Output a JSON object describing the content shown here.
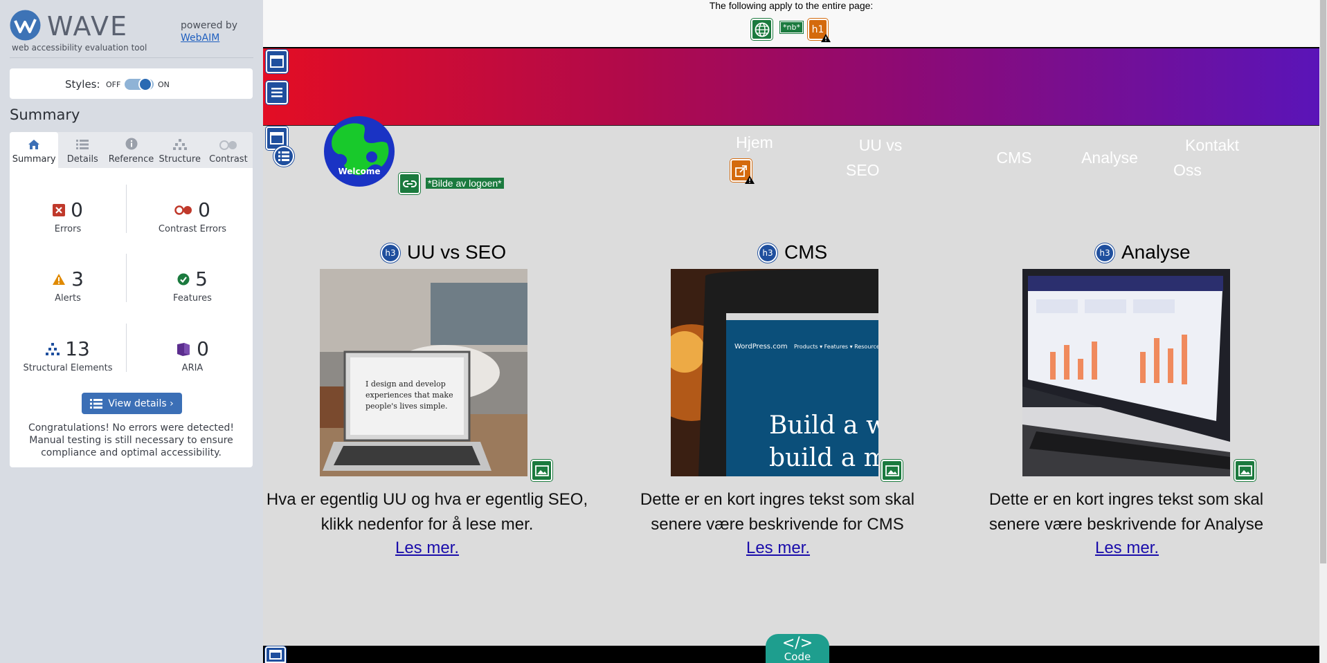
{
  "wave": {
    "logo_text": "WAVE",
    "logo_subtitle": "web accessibility evaluation tool",
    "powered_by": "powered by",
    "powered_link": "WebAIM",
    "styles_label": "Styles:",
    "toggle_off": "OFF",
    "toggle_on": "ON",
    "summary_title": "Summary",
    "tabs": [
      {
        "label": "Summary",
        "icon": "home-icon",
        "active": true
      },
      {
        "label": "Details",
        "icon": "list-icon",
        "active": false
      },
      {
        "label": "Reference",
        "icon": "info-icon",
        "active": false
      },
      {
        "label": "Structure",
        "icon": "hierarchy-icon",
        "active": false
      },
      {
        "label": "Contrast",
        "icon": "contrast-icon",
        "active": false
      }
    ],
    "stats": {
      "errors": {
        "value": "0",
        "label": "Errors",
        "color": "#c0392b"
      },
      "contrast_errors": {
        "value": "0",
        "label": "Contrast Errors",
        "color": "#c0392b"
      },
      "alerts": {
        "value": "3",
        "label": "Alerts",
        "color": "#e08a00"
      },
      "features": {
        "value": "5",
        "label": "Features",
        "color": "#1b7a3e"
      },
      "structural": {
        "value": "13",
        "label": "Structural Elements",
        "color": "#1f4f9e"
      },
      "aria": {
        "value": "0",
        "label": "ARIA",
        "color": "#5b2d8e"
      }
    },
    "view_details": "View details ›",
    "congrats": "Congratulations! No errors were detected! Manual testing is still necessary to ensure compliance and optimal accessibility."
  },
  "page": {
    "apply_text": "The following apply to the entire page:",
    "lang_badge": "*nb*",
    "h1_badge": "h1",
    "logo_caption": "Welcome",
    "logo_alt": "*Bilde av logoen*",
    "nav": [
      {
        "line1": "Hjem",
        "line2": ""
      },
      {
        "line1": "UU vs",
        "line2": "SEO"
      },
      {
        "line1": "CMS",
        "line2": ""
      },
      {
        "line1": "Analyse",
        "line2": ""
      },
      {
        "line1": "Kontakt",
        "line2": "Oss"
      }
    ],
    "h3_badge": "h3",
    "cards": [
      {
        "title": "UU vs SEO",
        "text_line1": "Hva er egentlig UU og hva er egentlig SEO,",
        "text_line2": "klikk nedenfor for å lese mer.",
        "link": "Les mer.",
        "image_text": "I design and develop experiences that make people's lives simple."
      },
      {
        "title": "CMS",
        "text_line1": "Dette er en kort ingres tekst som skal",
        "text_line2": "senere være beskrivende for CMS",
        "link": "Les mer.",
        "image_text": "Build a webs build a move"
      },
      {
        "title": "Analyse",
        "text_line1": "Dette er en kort ingres tekst som skal",
        "text_line2": "senere være beskrivende for Analyse",
        "link": "Les mer.",
        "image_text": ""
      }
    ],
    "code_button": "Code",
    "code_glyph": "</>"
  },
  "colors": {
    "wave_blue": "#1f4f9e",
    "feature_green": "#1b7a3e",
    "alert_orange": "#d46a0d",
    "banner_start": "#e30d24",
    "banner_end": "#5a14b8",
    "link": "#1a0dab"
  }
}
